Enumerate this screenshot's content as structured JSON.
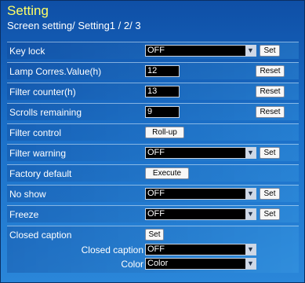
{
  "title": "Setting",
  "subtitle": "Screen setting/ Setting1 / 2/ 3",
  "icons": {
    "dropdown": "chevron-down-icon"
  },
  "rows": {
    "key_lock": {
      "label": "Key lock",
      "value": "OFF",
      "button": "Set"
    },
    "lamp_corres": {
      "label": "Lamp Corres.Value(h)",
      "value": "12",
      "button": "Reset"
    },
    "filter_counter": {
      "label": "Filter counter(h)",
      "value": "13",
      "button": "Reset"
    },
    "scrolls_remaining": {
      "label": "Scrolls remaining",
      "value": "9",
      "button": "Reset"
    },
    "filter_control": {
      "label": "Filter control",
      "button": "Roll-up"
    },
    "filter_warning": {
      "label": "Filter warning",
      "value": "OFF",
      "button": "Set"
    },
    "factory_default": {
      "label": "Factory default",
      "button": "Execute"
    },
    "no_show": {
      "label": "No show",
      "value": "OFF",
      "button": "Set"
    },
    "freeze": {
      "label": "Freeze",
      "value": "OFF",
      "button": "Set"
    },
    "closed_caption": {
      "label": "Closed caption",
      "button": "Set",
      "sub1": {
        "label": "Closed caption",
        "value": "OFF"
      },
      "sub2": {
        "label": "Color",
        "value": "Color"
      }
    }
  },
  "colors": {
    "title": "#ffff66",
    "panel_top": "#0f4fa6",
    "panel_bottom": "#2a86d9"
  }
}
